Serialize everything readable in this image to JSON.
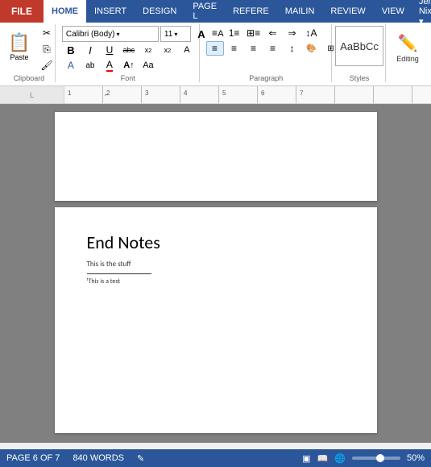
{
  "tabs": {
    "file": "FILE",
    "home": "HOME",
    "insert": "INSERT",
    "design": "DESIGN",
    "page_layout": "PAGE L",
    "references": "REFERE",
    "mailings": "MAILIN",
    "review": "REVIEW",
    "view": "VIEW"
  },
  "user": "Jerry Nixon ▾",
  "ribbon": {
    "clipboard": {
      "label": "Clipboard",
      "paste": "Paste",
      "cut_tooltip": "Cut",
      "copy_tooltip": "Copy",
      "format_painter": "Format Painter"
    },
    "font": {
      "label": "Font",
      "name": "Calibri (Body)",
      "size": "11",
      "bold": "B",
      "italic": "I",
      "underline": "U",
      "strikethrough": "abc",
      "subscript": "x₂",
      "superscript": "x²",
      "clear_format": "A",
      "font_color": "A",
      "highlight": "ab",
      "text_effects": "A"
    },
    "paragraph": {
      "label": "Paragraph"
    },
    "styles": {
      "label": "Styles",
      "preview": "AaBbCc"
    },
    "editing": {
      "label": "Editing",
      "icon": "✏"
    }
  },
  "ruler": {
    "numbers": [
      "1",
      "2",
      "3",
      "4",
      "5",
      "6",
      "7"
    ]
  },
  "document": {
    "end_notes_title": "End Notes",
    "end_notes_body": "This is the stuff",
    "footnote_text": "¹This is a test"
  },
  "status": {
    "page": "PAGE 6 OF 7",
    "words": "840 WORDS",
    "zoom": "50"
  }
}
